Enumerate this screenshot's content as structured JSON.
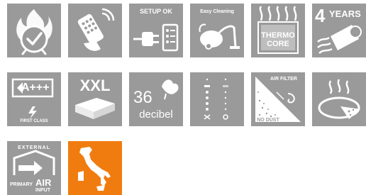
{
  "colors": {
    "tile": "#9a9a9a",
    "accent": "#f07c10",
    "glyph": "#ffffff"
  },
  "tiles": [
    {
      "icon": "flame-timer-icon"
    },
    {
      "icon": "remote-control-icon"
    },
    {
      "icon": "setup-ok-plug-icon",
      "label": "SETUP OK"
    },
    {
      "icon": "vacuum-cleaner-icon",
      "label": "Easy Cleaning"
    },
    {
      "icon": "thermo-core-icon",
      "label_top": "THERMO",
      "label_bottom": "CORE"
    },
    {
      "icon": "warranty-icon",
      "label_num": "4",
      "label_word": "YEARS"
    },
    {
      "icon": "energy-class-icon",
      "label": "A+++",
      "label_bottom": "FIRST CLASS"
    },
    {
      "icon": "xxl-capacity-icon",
      "label": "XXL"
    },
    {
      "icon": "noise-level-icon",
      "label_num": "36",
      "label_word": "decibel"
    },
    {
      "icon": "display-panel-icon"
    },
    {
      "icon": "air-filter-icon",
      "label_top": "AIR FILTER",
      "label_bottom": "NO DUST"
    },
    {
      "icon": "pizza-heat-icon"
    },
    {
      "icon": "external-air-icon",
      "label_top": "EXTERNAL",
      "label_primary": "PRIMARY",
      "label_air": "AIR",
      "label_input": "INPUT"
    },
    {
      "icon": "italy-map-icon"
    }
  ]
}
